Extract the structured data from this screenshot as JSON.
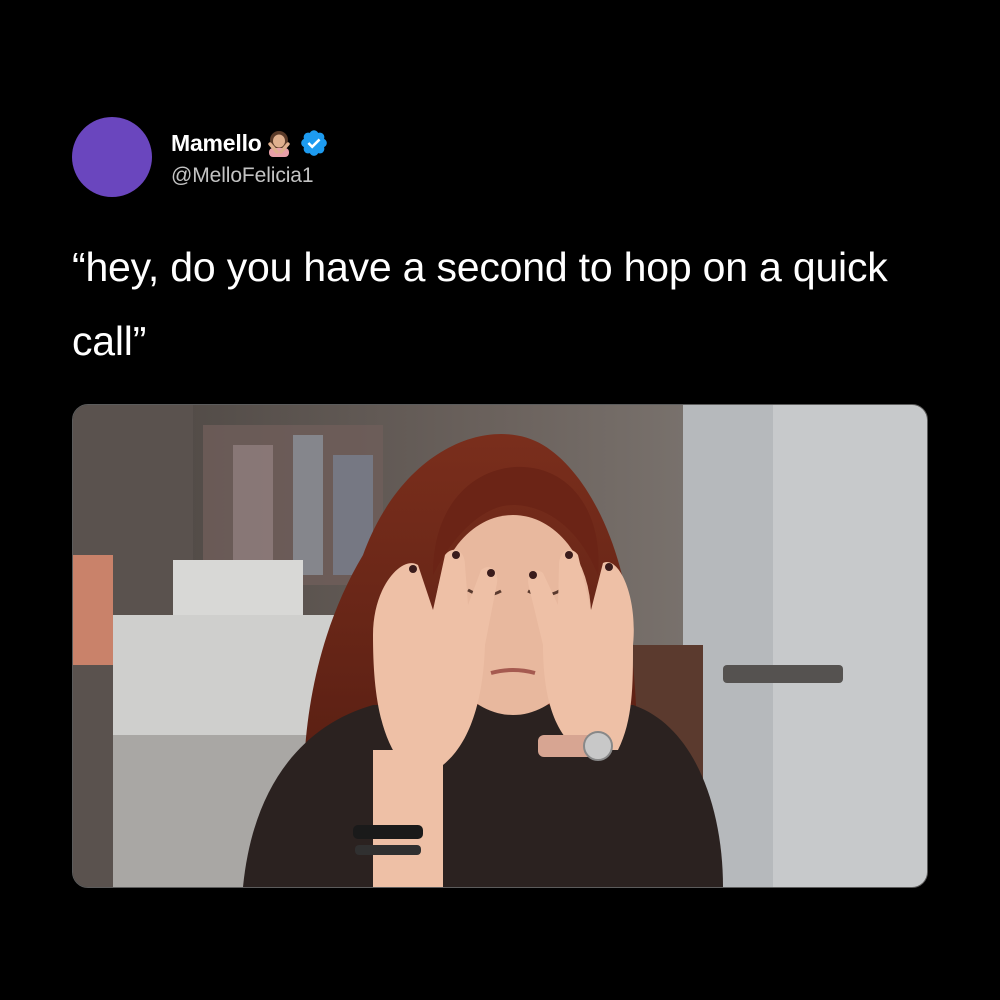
{
  "tweet": {
    "author": {
      "display_name": "Mamello",
      "handle": "@MelloFelicia1",
      "avatar_color": "#6a46be",
      "name_emoji": "woman-gesturing-no-emoji",
      "verified_badge": "verified-checkmark-icon",
      "verified_color": "#1d9bf0"
    },
    "text": "“hey, do you have a second to hop on a quick call”",
    "media": {
      "type": "gif-image",
      "subject": "woman-rubbing-eyes-photo"
    }
  },
  "colors": {
    "background": "#000000",
    "text_primary": "#ffffff",
    "text_secondary": "#c3c3c3",
    "media_border": "#5c5c5c"
  }
}
